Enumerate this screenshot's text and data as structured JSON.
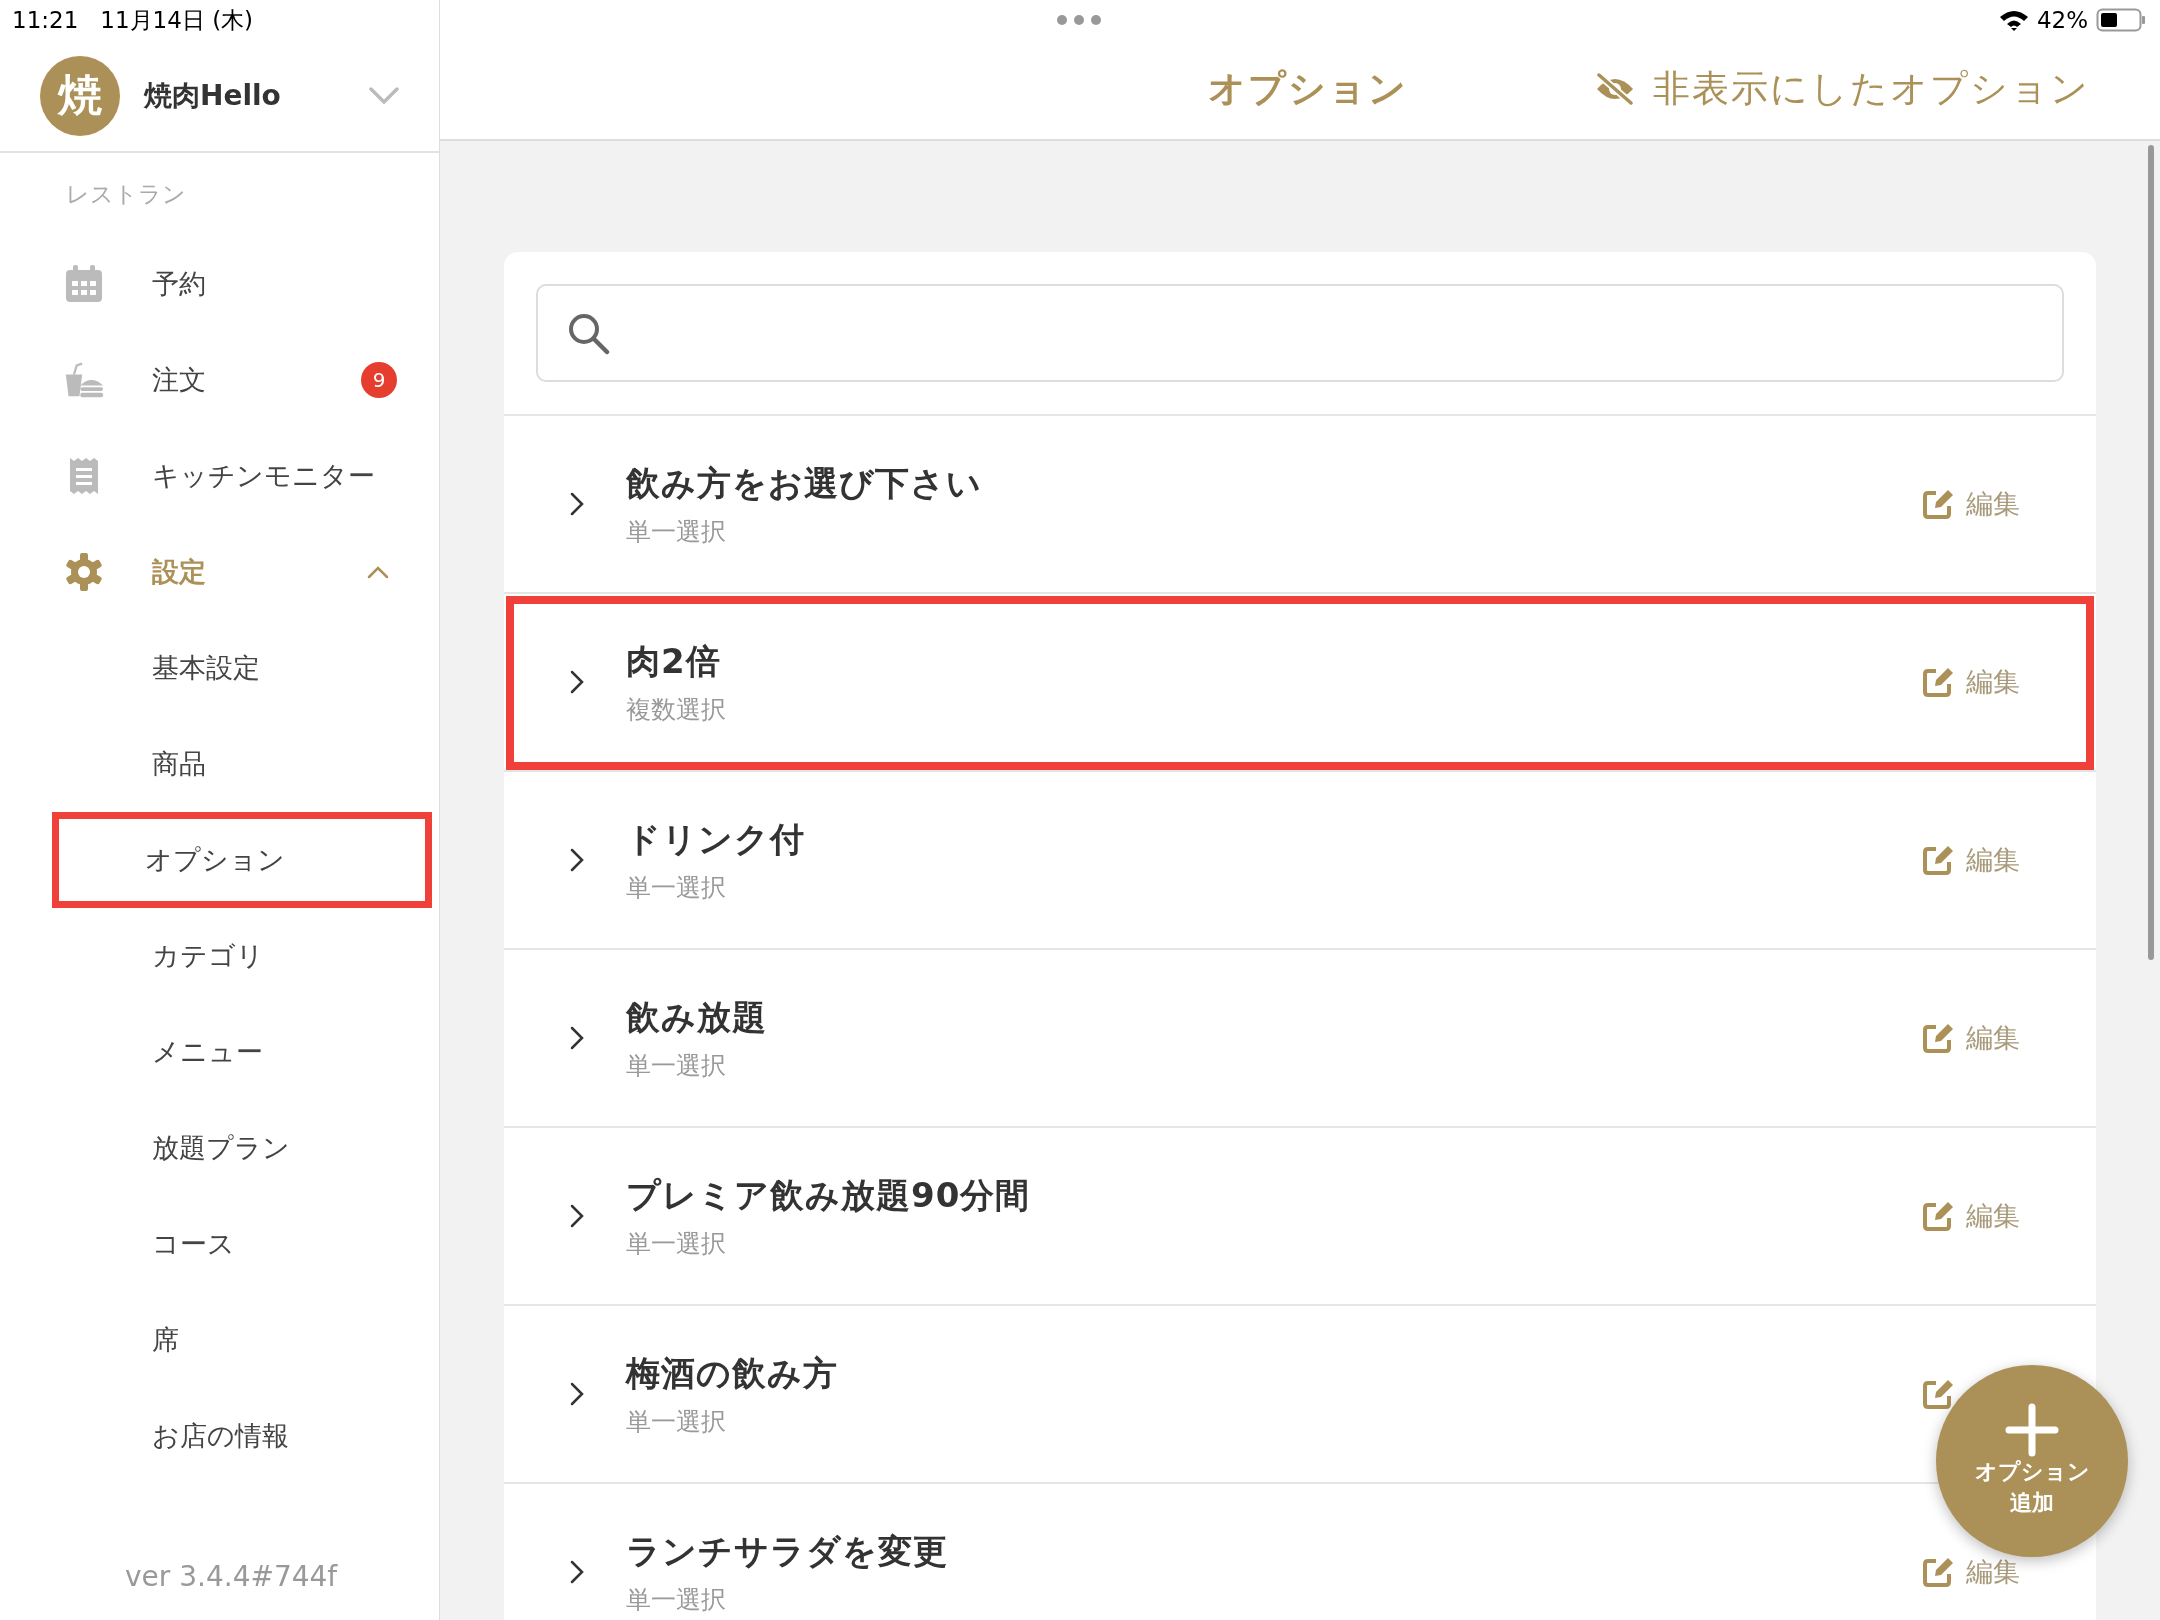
{
  "status_bar": {
    "time": "11:21",
    "date": "11月14日 (木)",
    "battery": "42%"
  },
  "account": {
    "avatar": "焼",
    "name": "焼肉Hello"
  },
  "sidebar": {
    "section": "レストラン",
    "items": [
      {
        "label": "予約",
        "kind": "calendar",
        "selected": false
      },
      {
        "label": "注文",
        "kind": "order",
        "badge": "9",
        "selected": false
      },
      {
        "label": "キッチンモニター",
        "kind": "receipt",
        "selected": false
      },
      {
        "label": "設定",
        "kind": "gear",
        "selected": true,
        "expanded": true,
        "children": [
          {
            "label": "基本設定",
            "highlighted": false
          },
          {
            "label": "商品",
            "highlighted": false
          },
          {
            "label": "オプション",
            "highlighted": true
          },
          {
            "label": "カテゴリ",
            "highlighted": false
          },
          {
            "label": "メニュー",
            "highlighted": false
          },
          {
            "label": "放題プラン",
            "highlighted": false
          },
          {
            "label": "コース",
            "highlighted": false
          },
          {
            "label": "席",
            "highlighted": false
          },
          {
            "label": "お店の情報",
            "highlighted": false
          }
        ]
      }
    ]
  },
  "version": "ver 3.4.4#744f",
  "header": {
    "title": "オプション",
    "hidden_link": "非表示にしたオプション"
  },
  "options": [
    {
      "name": "飲み方をお選び下さい",
      "type": "単一選択",
      "edit": "編集",
      "highlighted": false
    },
    {
      "name": "肉2倍",
      "type": "複数選択",
      "edit": "編集",
      "highlighted": true
    },
    {
      "name": "ドリンク付",
      "type": "単一選択",
      "edit": "編集",
      "highlighted": false
    },
    {
      "name": "飲み放題",
      "type": "単一選択",
      "edit": "編集",
      "highlighted": false
    },
    {
      "name": "プレミア飲み放題90分間",
      "type": "単一選択",
      "edit": "編集",
      "highlighted": false
    },
    {
      "name": "梅酒の飲み方",
      "type": "単一選択",
      "highlighted": false
    },
    {
      "name": "ランチサラダを変更",
      "type": "単一選択",
      "edit": "編集",
      "highlighted": false
    }
  ],
  "fab": {
    "lines": [
      "オプション",
      "追加"
    ]
  }
}
